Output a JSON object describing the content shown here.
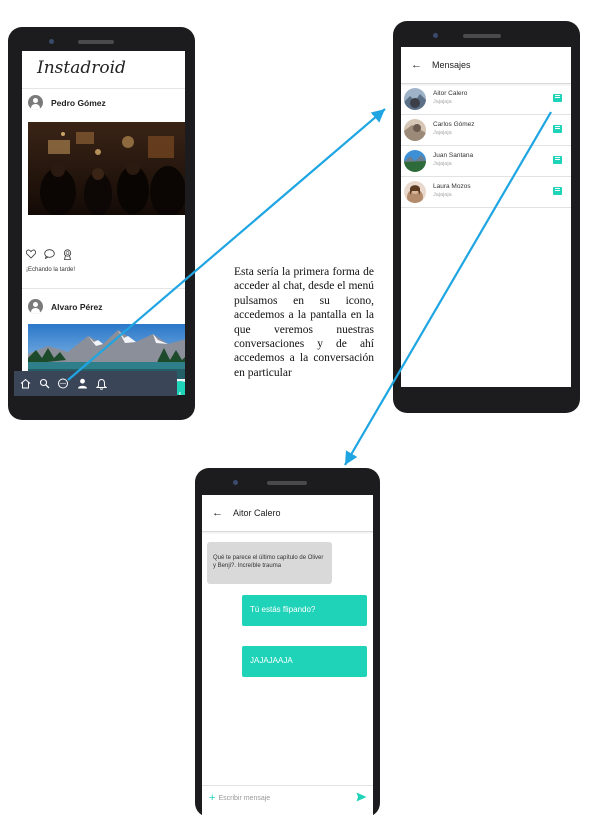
{
  "feed": {
    "brand": "Instadroid",
    "posts": [
      {
        "author": "Pedro Gómez",
        "caption": "¡Echando la tarde!"
      },
      {
        "author": "Alvaro Pérez"
      }
    ],
    "fab_label": "+"
  },
  "messages": {
    "title": "Mensajes",
    "conversations": [
      {
        "name": "Aitor Calero",
        "preview": "Jajajaja"
      },
      {
        "name": "Carlos Gómez",
        "preview": "Jajajaja"
      },
      {
        "name": "Juan Santana",
        "preview": "Jajajaja"
      },
      {
        "name": "Laura Mozos",
        "preview": "Jajajaja"
      }
    ]
  },
  "chat": {
    "title": "Aitor Calero",
    "messages": [
      {
        "from": "other",
        "text": "Qué te parece el último capítulo de Oliver y Benji?. Increíble trauma"
      },
      {
        "from": "me",
        "text": "Tú estás flipando?"
      },
      {
        "from": "me",
        "text": "JAJAJAAJA"
      }
    ],
    "input_placeholder": "Escribir mensaje"
  },
  "annotation": "Esta sería la primera forma de acceder al chat, desde el menú pulsamos en su icono, accedemos a la pantalla en la que veremos nuestras conversaciones y de ahí accedemos a la conversación en particular",
  "colors": {
    "accent": "#1fd3b8",
    "arrow": "#1ea5e2",
    "navbar": "#3a4558",
    "phone_body": "#1c1c1e"
  },
  "icons": [
    "home-icon",
    "search-icon",
    "chat-icon",
    "profile-icon",
    "bell-icon",
    "heart-icon",
    "comment-icon",
    "award-icon",
    "back-arrow-icon",
    "message-icon",
    "send-icon",
    "plus-icon"
  ]
}
